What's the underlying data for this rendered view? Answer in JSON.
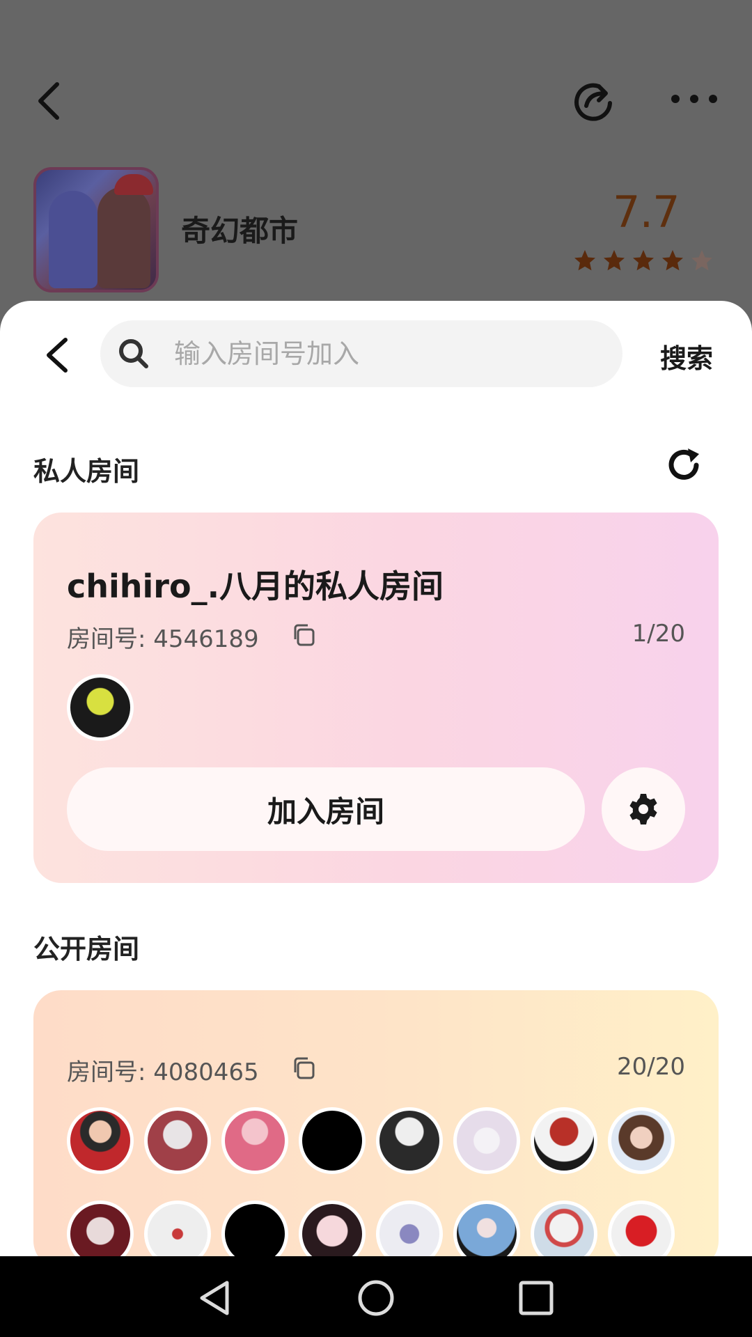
{
  "top": {
    "app_name": "奇幻都市",
    "score": "7.7",
    "rating_stars": 4.5,
    "icons": [
      "back-icon",
      "share-icon",
      "more-icon"
    ]
  },
  "search": {
    "placeholder": "输入房间号加入",
    "button_label": "搜索"
  },
  "private_section": {
    "title": "私人房间",
    "room": {
      "name": "chihiro_.八月的私人房间",
      "id_label": "房间号: 4546189",
      "count": "1/20",
      "join_label": "加入房间"
    }
  },
  "public_section": {
    "title": "公开房间",
    "room": {
      "id_label": "房间号: 4080465",
      "count": "20/20"
    }
  },
  "colors": {
    "score": "#5e2f0e",
    "star": "#5a2a0c",
    "private_card_start": "#fde3de",
    "private_card_end": "#f8d2ec",
    "public_card_start": "#fedcc8",
    "public_card_end": "#fff0c8"
  }
}
